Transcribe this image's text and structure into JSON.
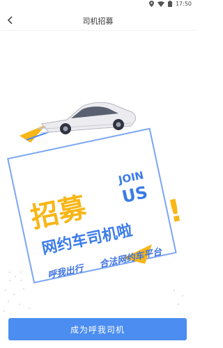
{
  "status_bar": {
    "time": "17:50"
  },
  "header": {
    "title": "司机招募"
  },
  "poster": {
    "headline": "招募",
    "join_word": "JOIN",
    "us_word": "US",
    "subtitle": "网约车司机啦",
    "slogan_left": "呼我出行",
    "slogan_right": "合法网约车平台",
    "exclaim": "!"
  },
  "footer": {
    "button_label": "成为呼我司机"
  },
  "colors": {
    "accent": "#4b8df0",
    "headline": "#f8b617",
    "brand_blue": "#3b7be8",
    "frame_blue": "#6b9cf2",
    "slogan": "#3f74e0"
  }
}
